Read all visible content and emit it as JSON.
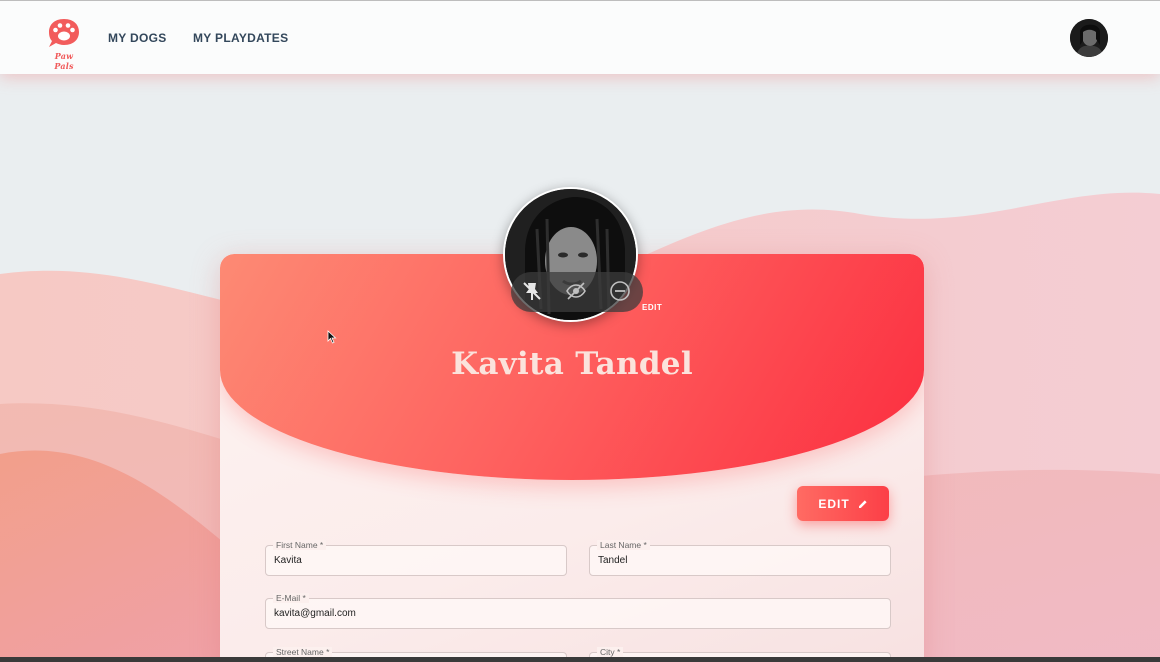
{
  "app": {
    "logo_text": "Paw Pals"
  },
  "nav": {
    "items": [
      {
        "label": "MY DOGS"
      },
      {
        "label": "MY PLAYDATES"
      }
    ]
  },
  "profile": {
    "name": "Kavita Tandel",
    "avatar_edit_label": "EDIT",
    "edit_button_label": "EDIT",
    "edit_button_icon": "pencil-icon",
    "overlay_icons": [
      "pin-off-icon",
      "eye-off-icon",
      "zoom-out-icon"
    ]
  },
  "form": {
    "fields": [
      {
        "label": "First Name *",
        "value": "Kavita"
      },
      {
        "label": "Last Name *",
        "value": "Tandel"
      },
      {
        "label": "E-Mail *",
        "value": "kavita@gmail.com"
      },
      {
        "label": "Street Name *",
        "value": ""
      },
      {
        "label": "City *",
        "value": ""
      }
    ]
  },
  "colors": {
    "accent": "#fc3f47",
    "accent_light": "#fd8a74",
    "nav_text": "#33475b"
  }
}
